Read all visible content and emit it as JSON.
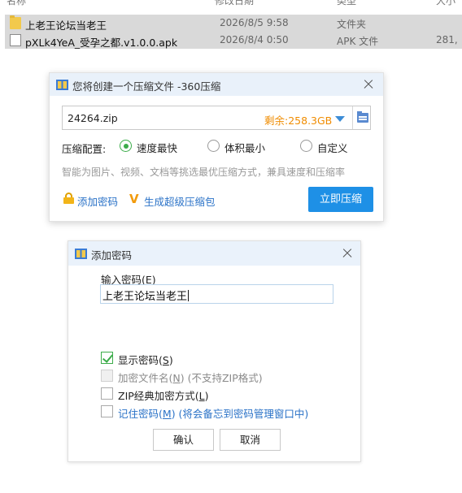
{
  "explorer": {
    "files": [
      {
        "name": "上老王论坛当老王",
        "date": "2026/8/5 9:58",
        "type": "文件夹",
        "size": "",
        "icon": "folder-icon"
      },
      {
        "name": "pXLk4YeA_受孕之都.v1.0.0.apk",
        "date": "2026/8/4 0:50",
        "type": "APK 文件",
        "size": "281,",
        "icon": "file-icon"
      }
    ]
  },
  "compress_dialog": {
    "title": "您将创建一个压缩文件 -360压缩",
    "filename": "24264.zip",
    "free_space": "剩余:258.3GB",
    "config_label": "压缩配置:",
    "options": [
      "速度最快",
      "体积最小",
      "自定义"
    ],
    "selected_option": "速度最快",
    "hint": "智能为图片、视频、文档等挑选最优压缩方式，兼具速度和压缩率",
    "add_password": "添加密码",
    "super_package": "生成超级压缩包",
    "compress_button": "立即压缩",
    "colors": {
      "accent": "#1e90e6",
      "free_space": "#f08c00",
      "link": "#2a72c7",
      "radio": "#3cac4a"
    }
  },
  "password_dialog": {
    "title": "添加密码",
    "input_label_pre": "输入密码(",
    "input_label_key": "E",
    "input_label_post": ")",
    "password_value": "上老王论坛当老王",
    "show_pwd_pre": "显示密码(",
    "show_pwd_key": "S",
    "show_pwd_post": ")",
    "show_pwd_checked": true,
    "encrypt_names_pre": "加密文件名(",
    "encrypt_names_key": "N",
    "encrypt_names_post": ") (不支持ZIP格式)",
    "zip_classic_pre": "ZIP经典加密方式(",
    "zip_classic_key": "L",
    "zip_classic_post": ")",
    "remember_pre": "记住密码(",
    "remember_key": "M",
    "remember_post": ") (将会备忘到密码管理窗口中)",
    "ok_button": "确认",
    "cancel_button": "取消"
  }
}
